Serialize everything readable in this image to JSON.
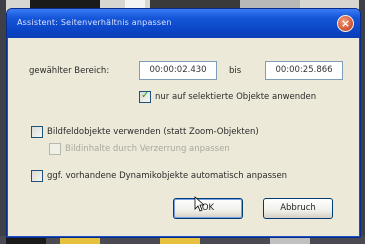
{
  "dialog": {
    "title": "Assistent: Seitenverhältnis anpassen",
    "close_label": "×",
    "range_label": "gewählter Bereich:",
    "range_from": "00:00:02.430",
    "range_to_label": "bis",
    "range_to": "00:00:25.866",
    "only_selected_label": "nur auf selektierte Objekte anwenden",
    "only_selected_checked": true,
    "use_image_objects_label": "Bildfeldobjekte verwenden (statt Zoom-Objekten)",
    "use_image_objects_checked": false,
    "adjust_image_label": "Bildinhalte durch Verzerrung anpassen",
    "adjust_image_checked": false,
    "auto_adjust_label": "ggf. vorhandene Dynamikobjekte automatisch anpassen",
    "auto_adjust_checked": false,
    "ok_label": "OK",
    "cancel_label": "Abbruch"
  },
  "colors": {
    "titlebar": "#0b46c8",
    "check_tick": "#21a121"
  }
}
